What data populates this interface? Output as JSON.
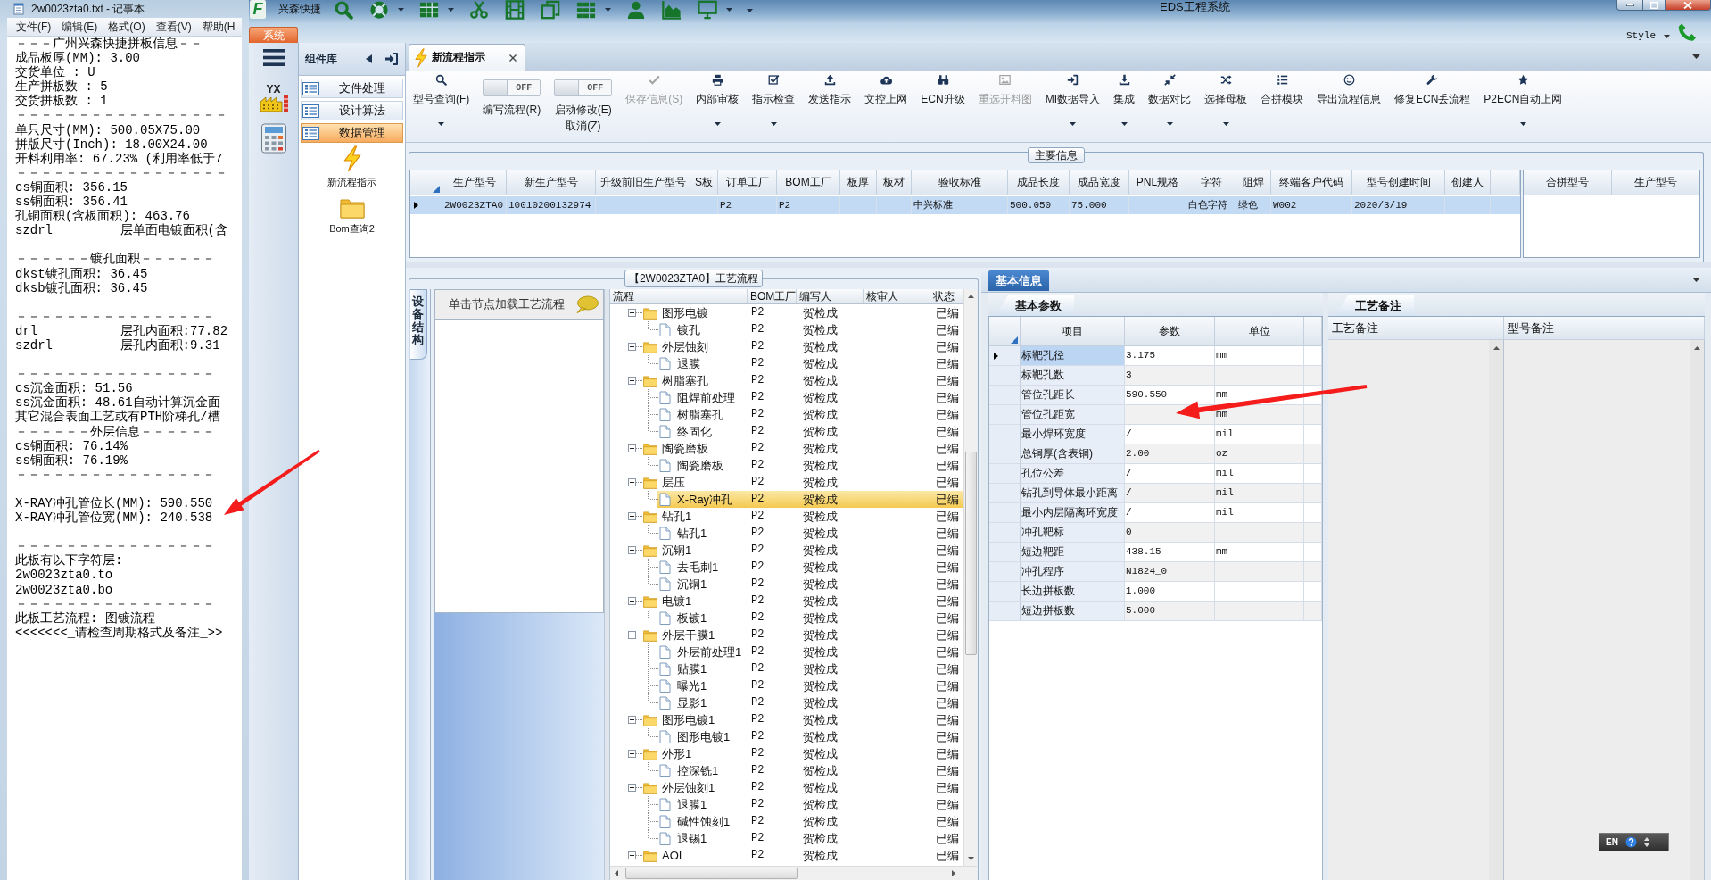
{
  "notepad": {
    "title": "2w0023zta0.txt - 记事本",
    "menu": [
      "文件(F)",
      "编辑(E)",
      "格式(O)",
      "查看(V)",
      "帮助(H"
    ],
    "paragraphs": [
      [
        "－－－广州兴森快捷拼板信息－－",
        "成品板厚(MM): 3.00",
        "交货单位 : U",
        "生产拼板数 : 5",
        "交货拼板数 : 1",
        "－－－－－－－－－－－－－－－－－",
        "单只尺寸(MM): 500.05X75.00",
        "拼版尺寸(Inch): 18.00X24.00",
        "开料利用率: 67.23% (利用率低于7",
        "－－－－－－－－－－－－－－－－－",
        "cs铜面积: 356.15",
        "ss铜面积: 356.41",
        "孔铜面积(含板面积): 463.76",
        "szdrl         层单面电镀面积(含"
      ],
      [
        "－－－－－－镀孔面积－－－－－－",
        "dkst镀孔面积: 36.45",
        "dksb镀孔面积: 36.45"
      ],
      [
        "－－－－－－－－－－－－－－－－",
        "drl           层孔内面积:77.82",
        "szdrl         层孔内面积:9.31"
      ],
      [
        "－－－－－－－－－－－－－－－－",
        "cs沉金面积: 51.56",
        "ss沉金面积: 48.61自动计算沉金面",
        "其它混合表面工艺或有PTH阶梯孔/槽",
        "－－－－－－外层信息－－－－－－",
        "cs铜面积: 76.14%",
        "ss铜面积: 76.19%",
        "－－－－－－－－－－－－－－－－"
      ],
      [
        "X-RAY冲孔管位长(MM): 590.550",
        "X-RAY冲孔管位宽(MM): 240.538"
      ],
      [
        "－－－－－－－－－－－－－－－－",
        "此板有以下字符层:",
        "2w0023zta0.to",
        "2w0023zta0.bo",
        "－－－－－－－－－－－－－－－－",
        "此板工艺流程: 图镀流程",
        "<<<<<<<_请检查周期格式及备注_>>"
      ]
    ]
  },
  "app": {
    "logo_text": "F",
    "brand": "兴森快捷",
    "title": "EDS工程系统",
    "quick_access": [
      {
        "dropdown": false
      },
      {
        "dropdown": true
      },
      {
        "dropdown": true
      },
      {
        "dropdown": false
      },
      {
        "dropdown": false
      },
      {
        "dropdown": false
      },
      {
        "dropdown": true
      },
      {
        "dropdown": false
      },
      {
        "dropdown": false
      },
      {
        "dropdown": true
      }
    ],
    "system_tab": "系统",
    "style_menu": "Style",
    "launcher_text": "YX",
    "library": {
      "title": "组件库",
      "items": [
        {
          "label": "文件处理",
          "selected": false
        },
        {
          "label": "设计算法",
          "selected": false
        },
        {
          "label": "数据管理",
          "selected": true
        }
      ],
      "shortcuts": [
        "新流程指示",
        "Bom查询2"
      ]
    },
    "document_tabs": [
      {
        "label": "新流程指示",
        "selected": true
      }
    ],
    "ribbon": [
      {
        "kind": "button",
        "label": "型号查询(F)",
        "dropdown": true,
        "disabled": false
      },
      {
        "kind": "toggle",
        "label": "编写流程(R)",
        "switch_text": "OFF",
        "on": false
      },
      {
        "kind": "toggle",
        "label": "启动修改(E)",
        "switch_text": "OFF",
        "on": false,
        "secondary_label": "取消(Z)"
      },
      {
        "kind": "button",
        "label": "保存信息(S)",
        "dropdown": false,
        "disabled": true
      },
      {
        "kind": "button",
        "label": "内部审核",
        "dropdown": true,
        "disabled": false
      },
      {
        "kind": "button",
        "label": "指示检查",
        "dropdown": true,
        "disabled": false
      },
      {
        "kind": "button",
        "label": "发送指示",
        "dropdown": false,
        "disabled": false
      },
      {
        "kind": "button",
        "label": "文控上网",
        "dropdown": false,
        "disabled": false
      },
      {
        "kind": "button",
        "label": "ECN升级",
        "dropdown": false,
        "disabled": false
      },
      {
        "kind": "button",
        "label": "重选开料图",
        "dropdown": false,
        "disabled": true
      },
      {
        "kind": "button",
        "label": "MI数据导入",
        "dropdown": true,
        "disabled": false
      },
      {
        "kind": "button",
        "label": "集成",
        "dropdown": true,
        "disabled": false
      },
      {
        "kind": "button",
        "label": "数据对比",
        "dropdown": true,
        "disabled": false
      },
      {
        "kind": "button",
        "label": "选择母板",
        "dropdown": true,
        "disabled": false
      },
      {
        "kind": "button",
        "label": "合拼模块",
        "dropdown": false,
        "disabled": false
      },
      {
        "kind": "button",
        "label": "导出流程信息",
        "dropdown": false,
        "disabled": false
      },
      {
        "kind": "button",
        "label": "修复ECN丢流程",
        "dropdown": false,
        "disabled": false
      },
      {
        "kind": "button",
        "label": "P2ECN自动上网",
        "dropdown": true,
        "disabled": false
      }
    ]
  },
  "main_info": {
    "caption": "主要信息",
    "columns": [
      "生产型号",
      "新生产型号",
      "升级前旧生产型号",
      "S板",
      "订单工厂",
      "BOM工厂",
      "板厚",
      "板材",
      "验收标准",
      "成品长度",
      "成品宽度",
      "PNL规格",
      "字符",
      "阻焊",
      "终端客户代码",
      "型号创建时间",
      "创建人"
    ],
    "rows": [
      {
        "selected": true,
        "cells": [
          "2W0023ZTA0",
          "10010200132974",
          null,
          null,
          "P2",
          "P2",
          null,
          null,
          "中兴标准",
          "500.050",
          "75.000",
          null,
          "白色字符",
          "绿色",
          "W002",
          "2020/3/19",
          null
        ]
      }
    ],
    "merge_columns": [
      "合拼型号",
      "生产型号"
    ]
  },
  "process_flow": {
    "caption": "【2W0023ZTA0】工艺流程",
    "side_tab": "设备结构",
    "hint": "单击节点加载工艺流程",
    "columns": [
      "流程",
      "BOM工厂",
      "编写人",
      "核审人",
      "状态"
    ],
    "nodes": [
      {
        "label": "图形电镀",
        "bom_factory": "P2",
        "author": "贺检成",
        "status": "已编",
        "expanded": true,
        "selected": false,
        "children": [
          {
            "label": "镀孔",
            "bom_factory": "P2",
            "author": "贺检成",
            "status": "已编",
            "selected": false
          }
        ]
      },
      {
        "label": "外层蚀刻",
        "bom_factory": "P2",
        "author": "贺检成",
        "status": "已编",
        "expanded": true,
        "selected": false,
        "children": [
          {
            "label": "退膜",
            "bom_factory": "P2",
            "author": "贺检成",
            "status": "已编",
            "selected": false
          }
        ]
      },
      {
        "label": "树脂塞孔",
        "bom_factory": "P2",
        "author": "贺检成",
        "status": "已编",
        "expanded": true,
        "selected": false,
        "children": [
          {
            "label": "阻焊前处理",
            "bom_factory": "P2",
            "author": "贺检成",
            "status": "已编",
            "selected": false
          },
          {
            "label": "树脂塞孔",
            "bom_factory": "P2",
            "author": "贺检成",
            "status": "已编",
            "selected": false
          },
          {
            "label": "终固化",
            "bom_factory": "P2",
            "author": "贺检成",
            "status": "已编",
            "selected": false
          }
        ]
      },
      {
        "label": "陶瓷磨板",
        "bom_factory": "P2",
        "author": "贺检成",
        "status": "已编",
        "expanded": true,
        "selected": false,
        "children": [
          {
            "label": "陶瓷磨板",
            "bom_factory": "P2",
            "author": "贺检成",
            "status": "已编",
            "selected": false
          }
        ]
      },
      {
        "label": "层压",
        "bom_factory": "P2",
        "author": "贺检成",
        "status": "已编",
        "expanded": true,
        "selected": false,
        "children": [
          {
            "label": "X-Ray冲孔",
            "bom_factory": "P2",
            "author": "贺检成",
            "status": "已编",
            "selected": true
          }
        ]
      },
      {
        "label": "钻孔1",
        "bom_factory": "P2",
        "author": "贺检成",
        "status": "已编",
        "expanded": true,
        "selected": false,
        "children": [
          {
            "label": "钻孔1",
            "bom_factory": "P2",
            "author": "贺检成",
            "status": "已编",
            "selected": false
          }
        ]
      },
      {
        "label": "沉铜1",
        "bom_factory": "P2",
        "author": "贺检成",
        "status": "已编",
        "expanded": true,
        "selected": false,
        "children": [
          {
            "label": "去毛刺1",
            "bom_factory": "P2",
            "author": "贺检成",
            "status": "已编",
            "selected": false
          },
          {
            "label": "沉铜1",
            "bom_factory": "P2",
            "author": "贺检成",
            "status": "已编",
            "selected": false
          }
        ]
      },
      {
        "label": "电镀1",
        "bom_factory": "P2",
        "author": "贺检成",
        "status": "已编",
        "expanded": true,
        "selected": false,
        "children": [
          {
            "label": "板镀1",
            "bom_factory": "P2",
            "author": "贺检成",
            "status": "已编",
            "selected": false
          }
        ]
      },
      {
        "label": "外层干膜1",
        "bom_factory": "P2",
        "author": "贺检成",
        "status": "已编",
        "expanded": true,
        "selected": false,
        "children": [
          {
            "label": "外层前处理1",
            "bom_factory": "P2",
            "author": "贺检成",
            "status": "已编",
            "selected": false
          },
          {
            "label": "贴膜1",
            "bom_factory": "P2",
            "author": "贺检成",
            "status": "已编",
            "selected": false
          },
          {
            "label": "曝光1",
            "bom_factory": "P2",
            "author": "贺检成",
            "status": "已编",
            "selected": false
          },
          {
            "label": "显影1",
            "bom_factory": "P2",
            "author": "贺检成",
            "status": "已编",
            "selected": false
          }
        ]
      },
      {
        "label": "图形电镀1",
        "bom_factory": "P2",
        "author": "贺检成",
        "status": "已编",
        "expanded": true,
        "selected": false,
        "children": [
          {
            "label": "图形电镀1",
            "bom_factory": "P2",
            "author": "贺检成",
            "status": "已编",
            "selected": false
          }
        ]
      },
      {
        "label": "外形1",
        "bom_factory": "P2",
        "author": "贺检成",
        "status": "已编",
        "expanded": true,
        "selected": false,
        "children": [
          {
            "label": "控深铣1",
            "bom_factory": "P2",
            "author": "贺检成",
            "status": "已编",
            "selected": false
          }
        ]
      },
      {
        "label": "外层蚀刻1",
        "bom_factory": "P2",
        "author": "贺检成",
        "status": "已编",
        "expanded": true,
        "selected": false,
        "children": [
          {
            "label": "退膜1",
            "bom_factory": "P2",
            "author": "贺检成",
            "status": "已编",
            "selected": false
          },
          {
            "label": "碱性蚀刻1",
            "bom_factory": "P2",
            "author": "贺检成",
            "status": "已编",
            "selected": false
          },
          {
            "label": "退锡1",
            "bom_factory": "P2",
            "author": "贺检成",
            "status": "已编",
            "selected": false
          }
        ]
      },
      {
        "label": "AOI",
        "bom_factory": "P2",
        "author": "贺检成",
        "status": "已编",
        "expanded": true,
        "selected": false
      }
    ]
  },
  "basic_info": {
    "tabs": [
      {
        "label": "基本信息",
        "selected": true
      }
    ],
    "params_tabs": [
      {
        "label": "基本参数",
        "selected": true
      }
    ],
    "columns": [
      "项目",
      "参数",
      "单位"
    ],
    "rows": [
      {
        "item": "标靶孔径",
        "value": "3.175",
        "unit": "mm",
        "selected": true
      },
      {
        "item": "标靶孔数",
        "value": "3",
        "selected": false
      },
      {
        "item": "管位孔距长",
        "value": "590.550",
        "unit": "mm",
        "selected": false
      },
      {
        "item": "管位孔距宽",
        "unit": "mm",
        "selected": false
      },
      {
        "item": "最小焊环宽度",
        "value": "/",
        "unit": "mil",
        "selected": false
      },
      {
        "item": "总铜厚(含表铜)",
        "value": "2.00",
        "unit": "oz",
        "selected": false
      },
      {
        "item": "孔位公差",
        "value": "/",
        "unit": "mil",
        "selected": false
      },
      {
        "item": "钻孔到导体最小距离",
        "value": "/",
        "unit": "mil",
        "selected": false
      },
      {
        "item": "最小内层隔离环宽度",
        "value": "/",
        "unit": "mil",
        "selected": false
      },
      {
        "item": "冲孔靶标",
        "value": "0",
        "selected": false
      },
      {
        "item": "短边靶距",
        "value": "438.15",
        "unit": "mm",
        "selected": false
      },
      {
        "item": "冲孔程序",
        "value": "N1824_0",
        "selected": false
      },
      {
        "item": "长边拼板数",
        "value": "1.000",
        "selected": false
      },
      {
        "item": "短边拼板数",
        "value": "5.000",
        "selected": false
      }
    ],
    "notes_tabs": [
      {
        "label": "工艺备注",
        "selected": true
      }
    ],
    "notes_columns": [
      "工艺备注",
      "型号备注"
    ]
  },
  "language_bar": {
    "language": "EN"
  }
}
